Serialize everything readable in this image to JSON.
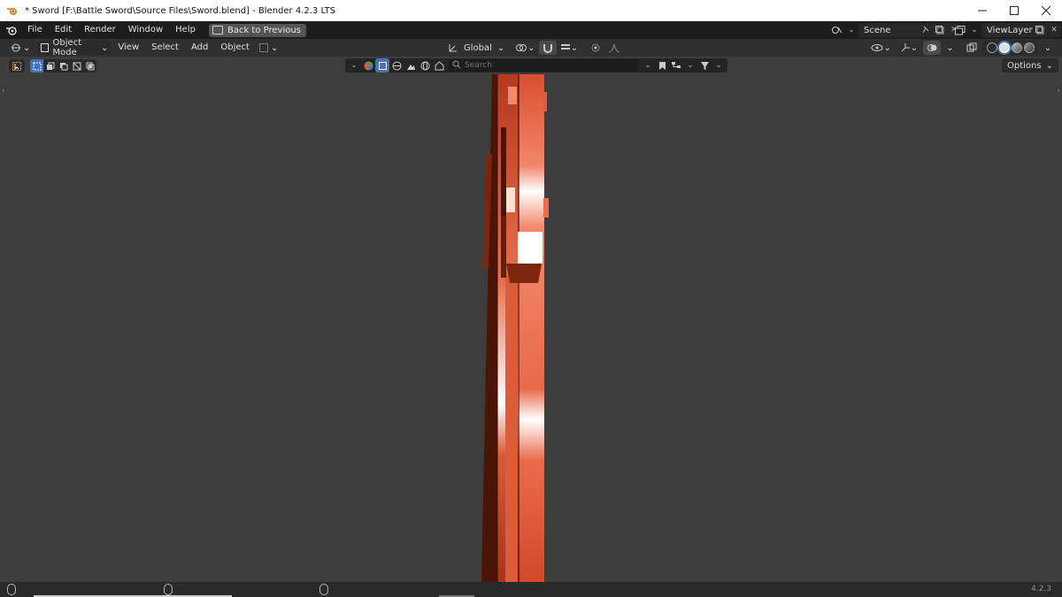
{
  "window": {
    "title": "* Sword [F:\\Battle Sword\\Source Files\\Sword.blend] - Blender 4.2.3 LTS",
    "controls": [
      "minimize",
      "maximize",
      "close"
    ]
  },
  "menu": {
    "items": [
      "File",
      "Edit",
      "Render",
      "Window",
      "Help"
    ],
    "back_label": "Back to Previous"
  },
  "scene": {
    "name": "Scene"
  },
  "view_layer": {
    "name": "ViewLayer"
  },
  "header": {
    "mode": "Object Mode",
    "menus": [
      "View",
      "Select",
      "Add",
      "Object"
    ],
    "transform_orientation": "Global"
  },
  "toolrow": {
    "search_placeholder": "Search",
    "options_label": "Options"
  },
  "status": {
    "version": "4.2.3"
  },
  "colors": {
    "sword_orange": "#e0633f",
    "viewport_bg": "#3d3d3d",
    "topbar_bg": "#1d1d1d",
    "accent_blue": "#4772b3"
  }
}
